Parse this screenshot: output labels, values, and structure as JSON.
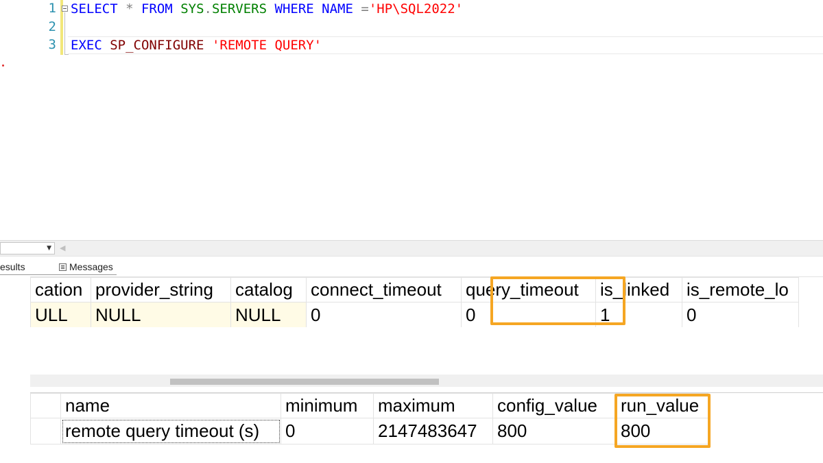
{
  "editor": {
    "line_numbers": [
      "1",
      "2",
      "3"
    ],
    "line1": {
      "kw_select": "SELECT",
      "op_star": " * ",
      "kw_from": "FROM",
      "space1": " ",
      "obj_sys": "SYS",
      "op_dot": ".",
      "obj_servers": "SERVERS",
      "space2": " ",
      "kw_where": "WHERE",
      "space3": " ",
      "plain_name": "NAME",
      "op_eq": " =",
      "str_value": "'HP\\SQL2022'"
    },
    "line3": {
      "kw_exec": "EXEC",
      "space1": " ",
      "proc_name": "SP_CONFIGURE",
      "space2": " ",
      "str_value": "'REMOTE QUERY'"
    }
  },
  "results_tabs": {
    "results_label": "esults",
    "messages_label": "Messages"
  },
  "grid1": {
    "columns": [
      "cation",
      "provider_string",
      "catalog",
      "connect_timeout",
      "query_timeout",
      "is_linked",
      "is_remote_lo"
    ],
    "row": [
      "ULL",
      "NULL",
      "NULL",
      "0",
      "0",
      "1",
      "0"
    ]
  },
  "grid2": {
    "columns": [
      "name",
      "minimum",
      "maximum",
      "config_value",
      "run_value"
    ],
    "row": [
      "remote query timeout (s)",
      "0",
      "2147483647",
      "800",
      "800"
    ]
  },
  "colors": {
    "highlight_box": "#f5a623",
    "keyword": "#0000ff",
    "string": "#ff0000",
    "object": "#008000"
  }
}
